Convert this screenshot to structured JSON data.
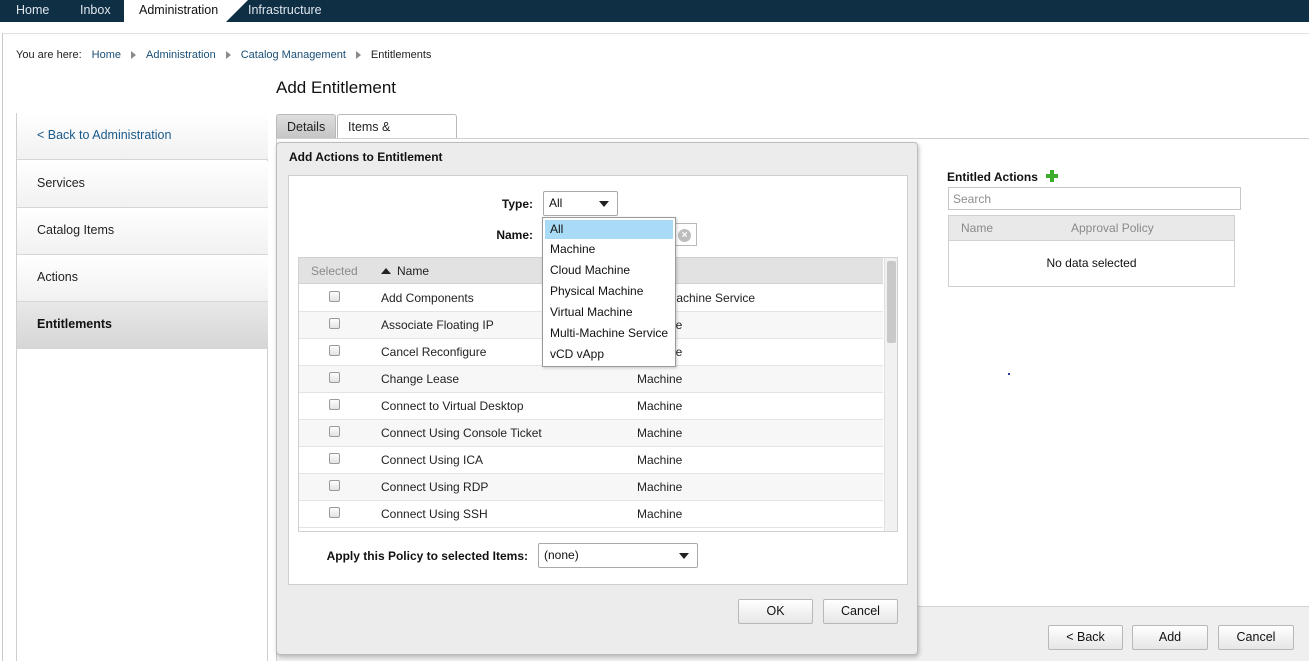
{
  "topnav": {
    "tabs": [
      {
        "label": "Home"
      },
      {
        "label": "Inbox"
      },
      {
        "label": "Administration"
      },
      {
        "label": "Infrastructure"
      }
    ]
  },
  "breadcrumb": {
    "lead": "You are here:",
    "items": [
      "Home",
      "Administration",
      "Catalog Management",
      "Entitlements"
    ]
  },
  "page": {
    "title": "Add Entitlement"
  },
  "sidebar": {
    "items": [
      {
        "label": "< Back to Administration"
      },
      {
        "label": "Services"
      },
      {
        "label": "Catalog Items"
      },
      {
        "label": "Actions"
      },
      {
        "label": "Entitlements"
      }
    ]
  },
  "tabs": {
    "details": "Details",
    "items_approvals": "Items & Approvals"
  },
  "entitled": {
    "title": "Entitled Actions",
    "search_placeholder": "Search",
    "col_name": "Name",
    "col_policy": "Approval Policy",
    "empty": "No data selected"
  },
  "footer": {
    "back": "< Back",
    "add": "Add",
    "cancel": "Cancel"
  },
  "modal": {
    "title": "Add Actions to Entitlement",
    "type_label": "Type:",
    "type_value": "All",
    "name_label": "Name:",
    "grid_headers": {
      "selected": "Selected",
      "name": "Name"
    },
    "rows": [
      {
        "name": "Add Components",
        "type": "Multi-Machine Service"
      },
      {
        "name": "Associate Floating IP",
        "type": "Machine"
      },
      {
        "name": "Cancel Reconfigure",
        "type": "Machine"
      },
      {
        "name": "Change Lease",
        "type": "Machine"
      },
      {
        "name": "Connect to Virtual Desktop",
        "type": "Machine"
      },
      {
        "name": "Connect Using Console Ticket",
        "type": "Machine"
      },
      {
        "name": "Connect Using ICA",
        "type": "Machine"
      },
      {
        "name": "Connect Using RDP",
        "type": "Machine"
      },
      {
        "name": "Connect Using SSH",
        "type": "Machine"
      }
    ],
    "policy_label": "Apply this Policy to selected Items:",
    "policy_value": "(none)",
    "ok": "OK",
    "cancel": "Cancel"
  },
  "type_dropdown": {
    "options": [
      "All",
      "Machine",
      "Cloud Machine",
      "Physical Machine",
      "Virtual Machine",
      "Multi-Machine Service",
      "vCD vApp"
    ],
    "selected": "All"
  }
}
